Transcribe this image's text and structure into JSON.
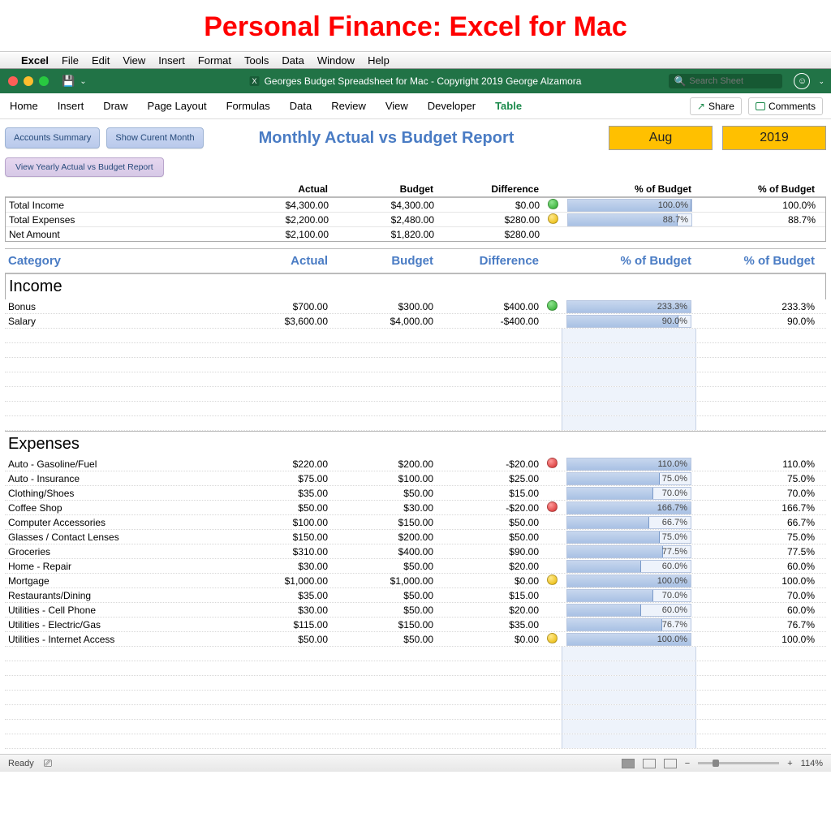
{
  "page_heading": "Personal Finance: Excel for Mac",
  "mac_menu": {
    "app": "Excel",
    "items": [
      "File",
      "Edit",
      "View",
      "Insert",
      "Format",
      "Tools",
      "Data",
      "Window",
      "Help"
    ]
  },
  "titlebar": {
    "document": "Georges Budget Spreadsheet for Mac - Copyright 2019 George Alzamora",
    "search_placeholder": "Search Sheet"
  },
  "ribbon": {
    "tabs": [
      "Home",
      "Insert",
      "Draw",
      "Page Layout",
      "Formulas",
      "Data",
      "Review",
      "View",
      "Developer",
      "Table"
    ],
    "active": "Table",
    "share": "Share",
    "comments": "Comments"
  },
  "controls": {
    "accounts_summary": "Accounts Summary",
    "show_current_month": "Show Curent Month",
    "yearly_report": "View Yearly Actual vs Budget Report"
  },
  "report": {
    "title": "Monthly Actual vs Budget Report",
    "month": "Aug",
    "year": "2019"
  },
  "summary_headers": {
    "actual": "Actual",
    "budget": "Budget",
    "difference": "Difference",
    "pct_bar": "% of Budget",
    "pct": "% of Budget"
  },
  "summary": [
    {
      "label": "Total Income",
      "actual": "$4,300.00",
      "budget": "$4,300.00",
      "diff": "$0.00",
      "ind": "green",
      "pct_bar": 100.0,
      "pct_bar_txt": "100.0%",
      "pct": "100.0%"
    },
    {
      "label": "Total Expenses",
      "actual": "$2,200.00",
      "budget": "$2,480.00",
      "diff": "$280.00",
      "ind": "yellow",
      "pct_bar": 88.7,
      "pct_bar_txt": "88.7%",
      "pct": "88.7%"
    },
    {
      "label": "Net Amount",
      "actual": "$2,100.00",
      "budget": "$1,820.00",
      "diff": "$280.00",
      "ind": "",
      "pct_bar": null,
      "pct_bar_txt": "",
      "pct": ""
    }
  ],
  "column_headers": {
    "category": "Category",
    "actual": "Actual",
    "budget": "Budget",
    "difference": "Difference",
    "pct_bar": "% of Budget",
    "pct": "% of Budget"
  },
  "sections": {
    "income_title": "Income",
    "income": [
      {
        "label": "Bonus",
        "actual": "$700.00",
        "budget": "$300.00",
        "diff": "$400.00",
        "ind": "green",
        "pct_bar": 233.3,
        "pct_bar_txt": "233.3%",
        "pct": "233.3%"
      },
      {
        "label": "Salary",
        "actual": "$3,600.00",
        "budget": "$4,000.00",
        "diff": "-$400.00",
        "ind": "",
        "pct_bar": 90.0,
        "pct_bar_txt": "90.0%",
        "pct": "90.0%"
      }
    ],
    "expenses_title": "Expenses",
    "expenses": [
      {
        "label": "Auto - Gasoline/Fuel",
        "actual": "$220.00",
        "budget": "$200.00",
        "diff": "-$20.00",
        "ind": "red",
        "pct_bar": 110.0,
        "pct_bar_txt": "110.0%",
        "pct": "110.0%"
      },
      {
        "label": "Auto - Insurance",
        "actual": "$75.00",
        "budget": "$100.00",
        "diff": "$25.00",
        "ind": "",
        "pct_bar": 75.0,
        "pct_bar_txt": "75.0%",
        "pct": "75.0%"
      },
      {
        "label": "Clothing/Shoes",
        "actual": "$35.00",
        "budget": "$50.00",
        "diff": "$15.00",
        "ind": "",
        "pct_bar": 70.0,
        "pct_bar_txt": "70.0%",
        "pct": "70.0%"
      },
      {
        "label": "Coffee Shop",
        "actual": "$50.00",
        "budget": "$30.00",
        "diff": "-$20.00",
        "ind": "red",
        "pct_bar": 166.7,
        "pct_bar_txt": "166.7%",
        "pct": "166.7%"
      },
      {
        "label": "Computer Accessories",
        "actual": "$100.00",
        "budget": "$150.00",
        "diff": "$50.00",
        "ind": "",
        "pct_bar": 66.7,
        "pct_bar_txt": "66.7%",
        "pct": "66.7%"
      },
      {
        "label": "Glasses / Contact Lenses",
        "actual": "$150.00",
        "budget": "$200.00",
        "diff": "$50.00",
        "ind": "",
        "pct_bar": 75.0,
        "pct_bar_txt": "75.0%",
        "pct": "75.0%"
      },
      {
        "label": "Groceries",
        "actual": "$310.00",
        "budget": "$400.00",
        "diff": "$90.00",
        "ind": "",
        "pct_bar": 77.5,
        "pct_bar_txt": "77.5%",
        "pct": "77.5%"
      },
      {
        "label": "Home - Repair",
        "actual": "$30.00",
        "budget": "$50.00",
        "diff": "$20.00",
        "ind": "",
        "pct_bar": 60.0,
        "pct_bar_txt": "60.0%",
        "pct": "60.0%"
      },
      {
        "label": "Mortgage",
        "actual": "$1,000.00",
        "budget": "$1,000.00",
        "diff": "$0.00",
        "ind": "yellow",
        "pct_bar": 100.0,
        "pct_bar_txt": "100.0%",
        "pct": "100.0%"
      },
      {
        "label": "Restaurants/Dining",
        "actual": "$35.00",
        "budget": "$50.00",
        "diff": "$15.00",
        "ind": "",
        "pct_bar": 70.0,
        "pct_bar_txt": "70.0%",
        "pct": "70.0%"
      },
      {
        "label": "Utilities - Cell Phone",
        "actual": "$30.00",
        "budget": "$50.00",
        "diff": "$20.00",
        "ind": "",
        "pct_bar": 60.0,
        "pct_bar_txt": "60.0%",
        "pct": "60.0%"
      },
      {
        "label": "Utilities - Electric/Gas",
        "actual": "$115.00",
        "budget": "$150.00",
        "diff": "$35.00",
        "ind": "",
        "pct_bar": 76.7,
        "pct_bar_txt": "76.7%",
        "pct": "76.7%"
      },
      {
        "label": "Utilities - Internet Access",
        "actual": "$50.00",
        "budget": "$50.00",
        "diff": "$0.00",
        "ind": "yellow",
        "pct_bar": 100.0,
        "pct_bar_txt": "100.0%",
        "pct": "100.0%"
      }
    ]
  },
  "statusbar": {
    "ready": "Ready",
    "zoom": "114%"
  }
}
